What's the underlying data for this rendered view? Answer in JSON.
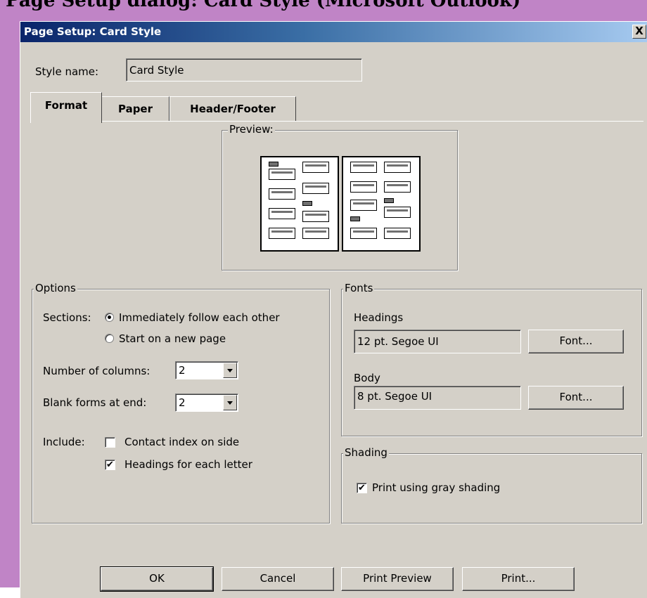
{
  "background": {
    "top_text": "Page Setup dialog: Card Style (Microsoft Outlook)"
  },
  "dialog": {
    "title": "Page Setup: Card Style",
    "close_glyph": "X",
    "style_name_label": "Style name:",
    "style_name_value": "Card Style",
    "tabs": [
      {
        "label": "Format",
        "active": true
      },
      {
        "label": "Paper",
        "active": false
      },
      {
        "label": "Header/Footer",
        "active": false
      }
    ],
    "preview_label": "Preview:",
    "options": {
      "legend": "Options",
      "sections_label": "Sections:",
      "radio_follow": "Immediately follow each other",
      "radio_newpage": "Start on a new page",
      "selected_section": "Immediately follow each other",
      "columns_label": "Number of columns:",
      "columns_value": "2",
      "blank_label": "Blank forms at end:",
      "blank_value": "2",
      "include_label": "Include:",
      "contact_index_label": "Contact index on side",
      "contact_index_checked": false,
      "headings_letter_label": "Headings for each letter",
      "headings_letter_checked": true,
      "check_glyph": "✔"
    },
    "fonts": {
      "legend": "Fonts",
      "headings_label": "Headings",
      "headings_value": "12 pt. Segoe UI",
      "body_label": "Body",
      "body_value": "8 pt. Segoe UI",
      "font_button": "Font..."
    },
    "shading": {
      "legend": "Shading",
      "gray_label": "Print using gray shading",
      "gray_checked": true
    },
    "buttons": {
      "ok": "OK",
      "cancel": "Cancel",
      "print_preview": "Print Preview",
      "print": "Print..."
    }
  }
}
